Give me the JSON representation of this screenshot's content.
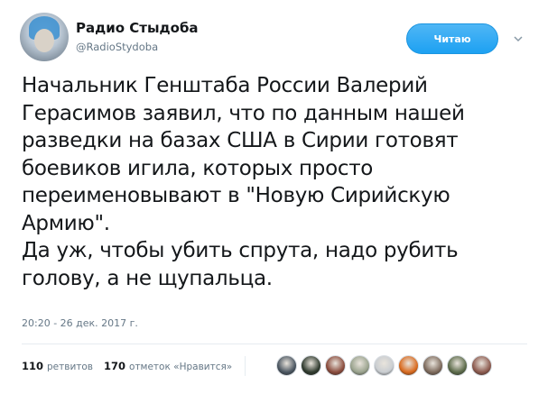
{
  "user": {
    "name": "Радио Стыдоба",
    "handle": "@RadioStydoba"
  },
  "follow_button": {
    "label": "Читаю"
  },
  "tweet": {
    "lines": [
      "Начальник Генштаба России Валерий",
      "Герасимов заявил, что по данным нашей",
      "разведки на базах США в Сирии готовят",
      "боевиков игила, которых просто",
      "переименовывают в \"Новую Сирийскую",
      "Армию\".",
      "Да уж, чтобы убить спрута, надо рубить",
      "голову, а не щупальца."
    ],
    "timestamp": "20:20 - 26 дек. 2017 г."
  },
  "stats": {
    "retweets_count": "110",
    "retweets_label": "ретвитов",
    "likes_count": "170",
    "likes_label": "отметок «Нравится»"
  },
  "liker_avatars": [
    {
      "icon": "avatar-icon",
      "color": "#4a5560"
    },
    {
      "icon": "avatar-icon",
      "color": "#2f3a2e"
    },
    {
      "icon": "avatar-icon",
      "color": "#8a4b3c"
    },
    {
      "icon": "avatar-icon",
      "color": "#9aa38e"
    },
    {
      "icon": "avatar-icon",
      "color": "#c9cdd1"
    },
    {
      "icon": "avatar-icon",
      "color": "#d96a1e"
    },
    {
      "icon": "avatar-icon",
      "color": "#7d6a5c"
    },
    {
      "icon": "avatar-icon",
      "color": "#5c6b4a"
    },
    {
      "icon": "avatar-icon",
      "color": "#8c5a4e"
    }
  ],
  "colors": {
    "accent": "#1da1f2",
    "secondary_text": "#657786",
    "primary_text": "#14171a"
  }
}
